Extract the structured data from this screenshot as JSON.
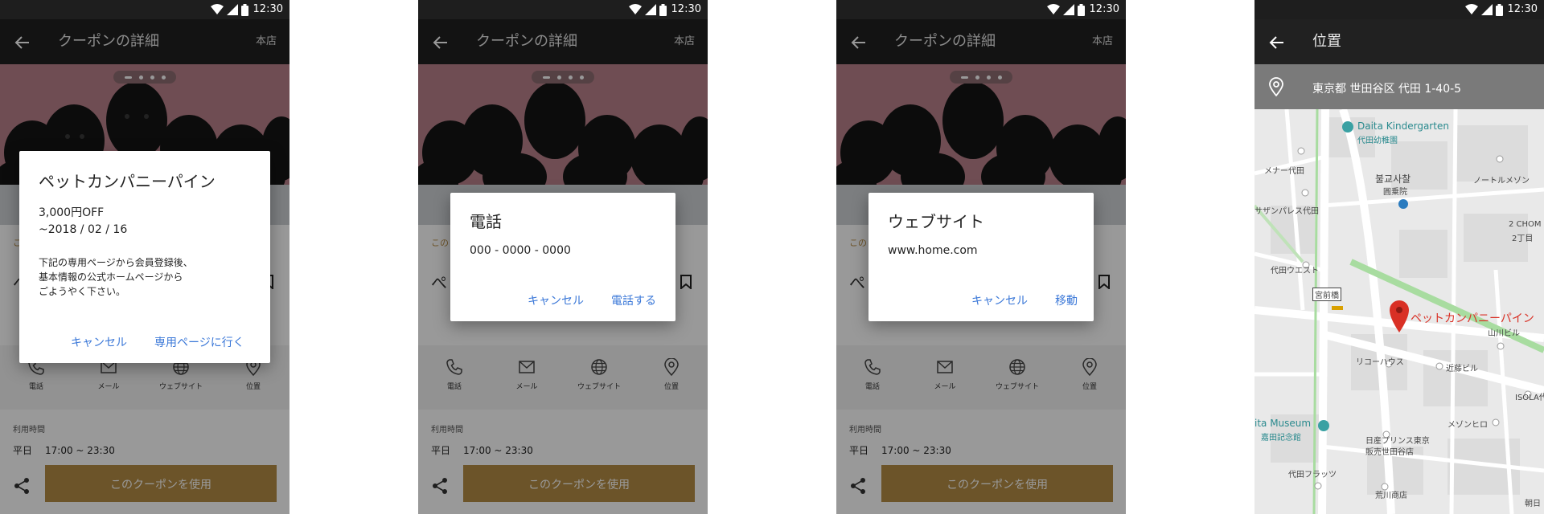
{
  "status_bar": {
    "time": "12:30"
  },
  "coupon_screen": {
    "title": "クーポンの詳細",
    "action": "本店",
    "card_sub": "この",
    "card_title": "ぺ",
    "actions": [
      {
        "label": "電話",
        "icon": "phone-icon"
      },
      {
        "label": "メール",
        "icon": "mail-icon"
      },
      {
        "label": "ウェブサイト",
        "icon": "globe-icon"
      },
      {
        "label": "位置",
        "icon": "location-pin-icon"
      }
    ],
    "hours_label": "利用時間",
    "hours_day": "平日",
    "hours_time": "17:00 ~ 23:30",
    "use_button": "このクーポンを使用"
  },
  "dialogs": {
    "coupon": {
      "title": "ペットカンパニーパイン",
      "discount": "3,000円OFF",
      "expiry": "~2018 / 02 / 16",
      "body_line1": "下記の専用ページから会員登録後、",
      "body_line2": "基本情報の公式ホームページから",
      "body_line3": "ごようやく下さい。",
      "cancel": "キャンセル",
      "confirm": "専用ページに行く"
    },
    "phone": {
      "title": "電話",
      "value": "000 - 0000 - 0000",
      "cancel": "キャンセル",
      "confirm": "電話する"
    },
    "website": {
      "title": "ウェブサイト",
      "value": "www.home.com",
      "cancel": "キャンセル",
      "confirm": "移動"
    }
  },
  "location_screen": {
    "title": "位置",
    "address": "東京都 世田谷区 代田 1-40-5",
    "map_labels": {
      "daita_kindergarten": "Daita Kindergarten",
      "daita_kindergarten_ja": "代田幼稚園",
      "mena_daita": "メナー代田",
      "temple_ko": "불교사찰",
      "temple_ja": "圓乗院",
      "noru_mezon": "ノートルメゾン",
      "sazanpalace": "サザンパレス代田",
      "daita_west": "代田ウエスト",
      "two_chome": "2 CHOM",
      "two_chome_ja": "2丁目",
      "miyamaebashi": "宮前橋",
      "pet_company": "ペットカンパニーパイン",
      "yamakawa": "山川ビル",
      "rico_house": "リコーハウス",
      "konto_bldg": "近藤ビル",
      "isola": "ISOLA代",
      "museum": "ita Museum",
      "museum_ja": "嘉田記念館",
      "mezon_hiro": "メゾンヒロ",
      "nissan": "日産プリンス東京",
      "nissan_2": "販売世田谷店",
      "daita_flats": "代田フラッツ",
      "arakawa": "荒川商店",
      "asahi": "朝日"
    }
  },
  "colors": {
    "accent": "#b58d45",
    "link": "#3b78d8",
    "app_bar": "#212121",
    "map_pin": "#d93025"
  }
}
